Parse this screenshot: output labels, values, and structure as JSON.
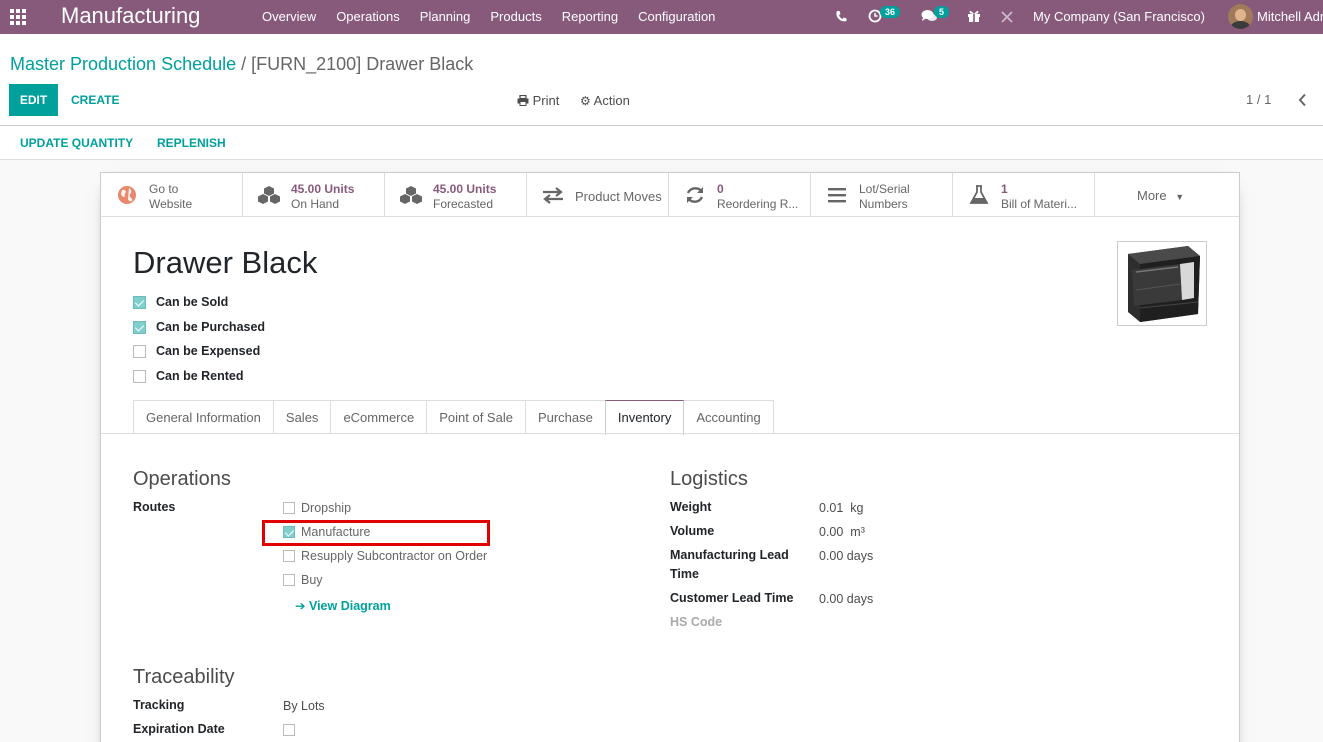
{
  "navbar": {
    "app_name": "Manufacturing",
    "menu": [
      "Overview",
      "Operations",
      "Planning",
      "Products",
      "Reporting",
      "Configuration"
    ],
    "activity_count": "36",
    "message_count": "5",
    "company": "My Company (San Francisco)",
    "user": "Mitchell Admin",
    "color": "#875a7b"
  },
  "breadcrumb": {
    "parent": "Master Production Schedule",
    "separator": "/",
    "current": "[FURN_2100] Drawer Black"
  },
  "toolbar": {
    "edit": "EDIT",
    "create": "CREATE",
    "print": "Print",
    "action": "Action",
    "pager": "1 / 1"
  },
  "statusbar": {
    "update_quantity": "UPDATE QUANTITY",
    "replenish": "REPLENISH"
  },
  "smart_buttons": {
    "website": {
      "line1": "Go to",
      "line2": "Website"
    },
    "on_hand": {
      "value": "45.00 Units",
      "label": "On Hand"
    },
    "forecasted": {
      "value": "45.00 Units",
      "label": "Forecasted"
    },
    "moves": {
      "label": "Product Moves"
    },
    "reordering": {
      "value": "0",
      "label": "Reordering R..."
    },
    "lots": {
      "line1": "Lot/Serial",
      "line2": "Numbers"
    },
    "bom": {
      "value": "1",
      "label": "Bill of Materi..."
    },
    "more": {
      "label": "More"
    }
  },
  "product": {
    "name": "Drawer Black",
    "flags": [
      {
        "label": "Can be Sold",
        "checked": true
      },
      {
        "label": "Can be Purchased",
        "checked": true
      },
      {
        "label": "Can be Expensed",
        "checked": false
      },
      {
        "label": "Can be Rented",
        "checked": false
      }
    ]
  },
  "tabs": [
    "General Information",
    "Sales",
    "eCommerce",
    "Point of Sale",
    "Purchase",
    "Inventory",
    "Accounting"
  ],
  "active_tab": "Inventory",
  "operations": {
    "title": "Operations",
    "routes_label": "Routes",
    "routes": [
      {
        "label": "Dropship",
        "checked": false
      },
      {
        "label": "Manufacture",
        "checked": true
      },
      {
        "label": "Resupply Subcontractor on Order",
        "checked": false
      },
      {
        "label": "Buy",
        "checked": false
      }
    ],
    "view_diagram": "View Diagram"
  },
  "logistics": {
    "title": "Logistics",
    "weight_label": "Weight",
    "weight_value": "0.01",
    "weight_unit": "kg",
    "volume_label": "Volume",
    "volume_value": "0.00",
    "volume_unit": "m³",
    "mlt_label_1": "Manufacturing Lead",
    "mlt_label_2": "Time",
    "mlt_value": "0.00 days",
    "clt_label": "Customer Lead Time",
    "clt_value": "0.00 days",
    "hs_label": "HS Code"
  },
  "traceability": {
    "title": "Traceability",
    "tracking_label": "Tracking",
    "tracking_value": "By Lots",
    "expiration_label": "Expiration Date",
    "expiration_checked": false
  }
}
